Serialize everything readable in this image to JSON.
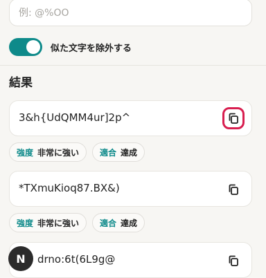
{
  "exclude_field": {
    "placeholder": "例: @%OO"
  },
  "toggle": {
    "label": "似た文字を除外する",
    "on": true
  },
  "results_section": {
    "title": "結果"
  },
  "results": [
    {
      "password": "3&h{UdQMM4ur]2p^",
      "strength_key": "強度",
      "strength_value": "非常に強い",
      "match_key": "適合",
      "match_value": "達成"
    },
    {
      "password": "*TXmuKioq87.BX&)",
      "strength_key": "強度",
      "strength_value": "非常に強い",
      "match_key": "適合",
      "match_value": "達成"
    },
    {
      "password": "drno:6t(6L9g@"
    }
  ],
  "avatar": {
    "initial": "N"
  },
  "colors": {
    "accent": "#0e8a8a",
    "highlight": "#d81e4f"
  }
}
